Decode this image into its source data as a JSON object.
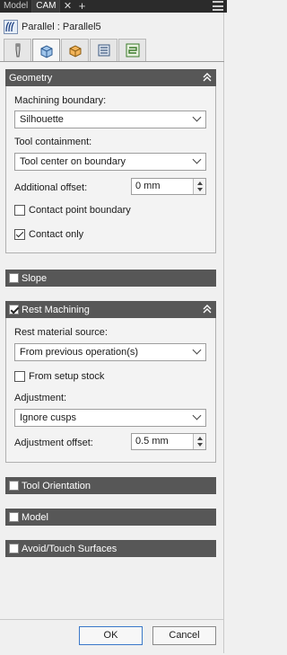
{
  "tabs": [
    {
      "label": "Model",
      "active": false
    },
    {
      "label": "CAM",
      "active": true
    }
  ],
  "tab_close_glyph": "✕",
  "tab_add_glyph": "+",
  "title": "Parallel : Parallel5",
  "icon_tabs": [
    "tool-icon",
    "geometry-icon",
    "heights-icon",
    "passes-icon",
    "linking-icon"
  ],
  "geometry": {
    "title": "Geometry",
    "machining_boundary_label": "Machining boundary:",
    "machining_boundary_value": "Silhouette",
    "tool_containment_label": "Tool containment:",
    "tool_containment_value": "Tool center on boundary",
    "additional_offset_label": "Additional offset:",
    "additional_offset_value": "0 mm",
    "contact_point_boundary_label": "Contact point boundary",
    "contact_point_boundary_checked": false,
    "contact_only_label": "Contact only",
    "contact_only_checked": true
  },
  "slope": {
    "title": "Slope",
    "checked": false
  },
  "rest_machining": {
    "title": "Rest Machining",
    "checked": true,
    "source_label": "Rest material source:",
    "source_value": "From previous operation(s)",
    "setup_stock_label": "From setup stock",
    "setup_stock_checked": false,
    "adjustment_label": "Adjustment:",
    "adjustment_value": "Ignore cusps",
    "adjustment_offset_label": "Adjustment offset:",
    "adjustment_offset_value": "0.5 mm"
  },
  "tool_orientation": {
    "title": "Tool Orientation",
    "checked": false
  },
  "model": {
    "title": "Model",
    "checked": false
  },
  "avoid_touch": {
    "title": "Avoid/Touch Surfaces",
    "checked": false
  },
  "buttons": {
    "ok": "OK",
    "cancel": "Cancel"
  },
  "colors": {
    "section_header": "#575757",
    "tab_bar": "#2b2b2b",
    "accent": "#3a78c9"
  }
}
